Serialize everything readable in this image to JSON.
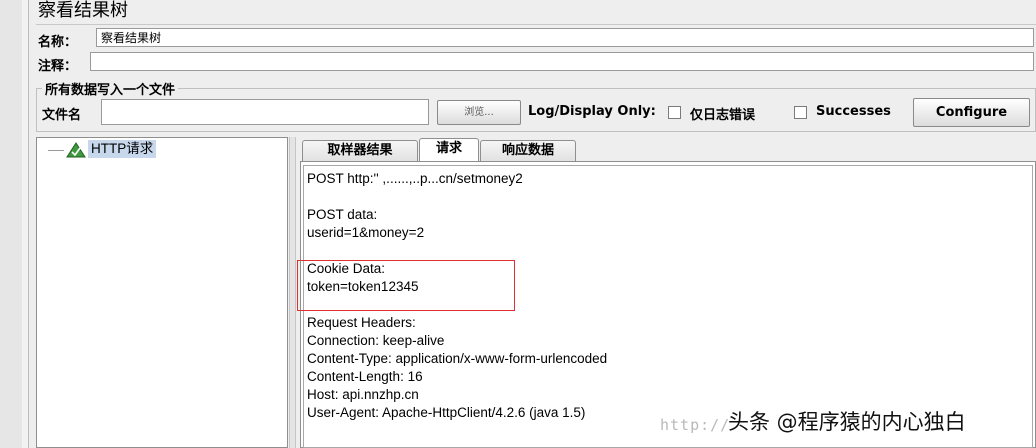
{
  "window": {
    "title": "察看结果树"
  },
  "form": {
    "name_label": "名称：",
    "name_value": "察看结果树",
    "comment_label": "注释：",
    "comment_value": ""
  },
  "file_group": {
    "legend": "所有数据写入一个文件",
    "filename_label": "文件名",
    "filename_value": "",
    "browse_label": "浏览...",
    "log_display_label": "Log/Display Only:",
    "errors_only_label": "仅日志错误",
    "errors_only_checked": false,
    "successes_label": "Successes",
    "successes_checked": false,
    "configure_label": "Configure"
  },
  "tree": {
    "items": [
      {
        "label": "HTTP请求",
        "icon": "success-triangle-icon"
      }
    ]
  },
  "tabs": [
    {
      "label": "取样器结果",
      "active": false
    },
    {
      "label": "请求",
      "active": true
    },
    {
      "label": "响应数据",
      "active": false
    }
  ],
  "request": {
    "lines": [
      "POST http:'' ,......,..p...cn/setmoney2",
      "",
      "POST data:",
      "userid=1&money=2",
      "",
      "Cookie Data:",
      "token=token12345",
      "",
      "Request Headers:",
      "Connection: keep-alive",
      "Content-Type: application/x-www-form-urlencoded",
      "Content-Length: 16",
      "Host: api.nnzhp.cn",
      "User-Agent: Apache-HttpClient/4.2.6 (java 1.5)"
    ]
  },
  "highlight": {
    "color": "#e03030"
  },
  "watermark": {
    "url_text": "http://",
    "author_text": "头条 @程序猿的内心独白"
  }
}
